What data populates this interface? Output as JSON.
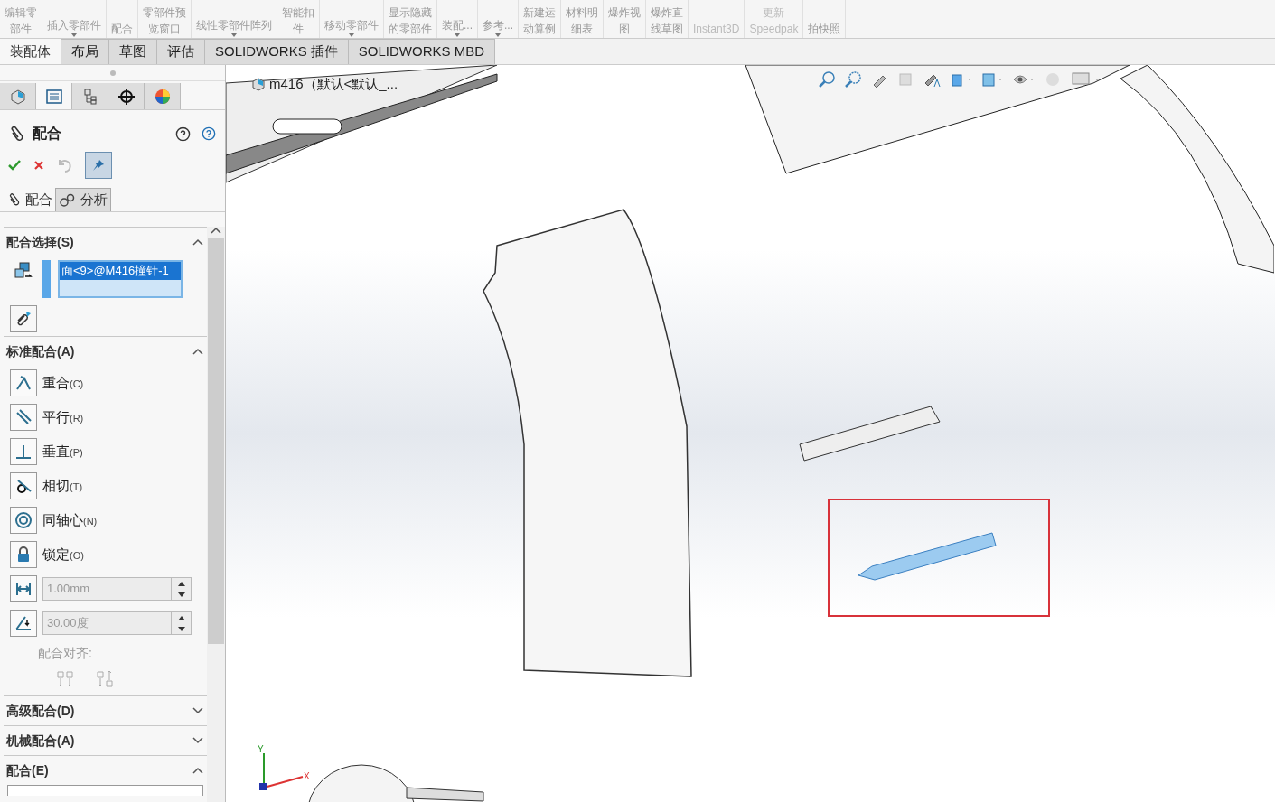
{
  "ribbon": {
    "items": [
      {
        "lines": [
          "编辑零",
          "部件"
        ],
        "dropdown": false,
        "disabled": false
      },
      {
        "lines": [
          "插入零部件"
        ],
        "dropdown": true,
        "disabled": false
      },
      {
        "lines": [
          "配合"
        ],
        "dropdown": false,
        "disabled": false
      },
      {
        "lines": [
          "零部件预",
          "览窗口"
        ],
        "dropdown": false,
        "disabled": false
      },
      {
        "lines": [
          "线性零部件阵列"
        ],
        "dropdown": true,
        "disabled": false
      },
      {
        "lines": [
          "智能扣",
          "件"
        ],
        "dropdown": false,
        "disabled": false
      },
      {
        "lines": [
          "移动零部件"
        ],
        "dropdown": true,
        "disabled": false
      },
      {
        "lines": [
          "显示隐藏",
          "的零部件"
        ],
        "dropdown": false,
        "disabled": false
      },
      {
        "lines": [
          "装配..."
        ],
        "dropdown": true,
        "disabled": false
      },
      {
        "lines": [
          "参考..."
        ],
        "dropdown": true,
        "disabled": false
      },
      {
        "lines": [
          "新建运",
          "动算例"
        ],
        "dropdown": false,
        "disabled": false
      },
      {
        "lines": [
          "材料明",
          "细表"
        ],
        "dropdown": false,
        "disabled": false
      },
      {
        "lines": [
          "爆炸视",
          "图"
        ],
        "dropdown": false,
        "disabled": false
      },
      {
        "lines": [
          "爆炸直",
          "线草图"
        ],
        "dropdown": false,
        "disabled": false
      },
      {
        "lines": [
          "Instant3D"
        ],
        "dropdown": false,
        "disabled": true
      },
      {
        "lines": [
          "更新",
          "Speedpak"
        ],
        "dropdown": false,
        "disabled": true
      },
      {
        "lines": [
          "拍快照"
        ],
        "dropdown": false,
        "disabled": false
      }
    ]
  },
  "tabs": [
    {
      "label": "装配体",
      "selected": true
    },
    {
      "label": "布局",
      "selected": false
    },
    {
      "label": "草图",
      "selected": false
    },
    {
      "label": "评估",
      "selected": false
    },
    {
      "label": "SOLIDWORKS 插件",
      "selected": false
    },
    {
      "label": "SOLIDWORKS MBD",
      "selected": false
    }
  ],
  "panel": {
    "icon_tabs": [
      {
        "kind": "feature",
        "selected": false
      },
      {
        "kind": "property",
        "selected": true
      },
      {
        "kind": "config",
        "selected": false
      },
      {
        "kind": "dim",
        "selected": false
      },
      {
        "kind": "display",
        "selected": false
      }
    ],
    "title": "配合",
    "pin_on": true,
    "sub_tabs": [
      {
        "kind": "mate",
        "label": "配合",
        "selected": true
      },
      {
        "kind": "analysis",
        "label": "分析",
        "selected": false
      }
    ],
    "sections": [
      {
        "kind": "selection",
        "title": "配合选择(S)",
        "expanded": true,
        "items": [
          {
            "text": "面<9>@M416撞针-1",
            "selected": true
          }
        ]
      },
      {
        "kind": "mates",
        "title": "标准配合(A)",
        "expanded": true,
        "options": [
          {
            "kind": "coincident",
            "label": "重合",
            "key": "(C)"
          },
          {
            "kind": "parallel",
            "label": "平行",
            "key": "(R)"
          },
          {
            "kind": "perpendicular",
            "label": "垂直",
            "key": "(P)"
          },
          {
            "kind": "tangent",
            "label": "相切",
            "key": "(T)"
          },
          {
            "kind": "concentric",
            "label": "同轴心",
            "key": "(N)"
          },
          {
            "kind": "lock",
            "label": "锁定",
            "key": "(O)"
          }
        ],
        "distance": {
          "value": "1.00mm",
          "disabled": true
        },
        "angle": {
          "value": "30.00度",
          "disabled": true
        },
        "alignment_label": "配合对齐:"
      },
      {
        "kind": "plain",
        "title": "高级配合(D)",
        "expanded": false
      },
      {
        "kind": "plain",
        "title": "机械配合(A)",
        "expanded": false
      },
      {
        "kind": "plain",
        "title": "配合(E)",
        "expanded": true
      }
    ]
  },
  "viewport": {
    "model_label": "m416（默认<默认_...",
    "triad": {
      "x": "X",
      "y": "Y"
    }
  }
}
